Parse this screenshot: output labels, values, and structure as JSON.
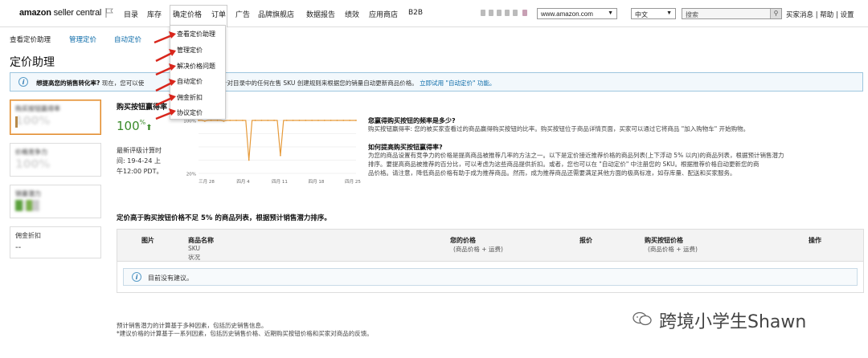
{
  "header": {
    "logo_bold": "amazon",
    "logo_rest": " seller central",
    "nav": [
      "目录",
      "库存",
      "确定价格",
      "订单",
      "广告",
      "品牌旗舰店",
      "数据报告",
      "绩效",
      "应用商店",
      "B2B"
    ],
    "marketplace": "www.amazon.com",
    "language": "中文",
    "search_placeholder": "搜索",
    "links": "买家消息 | 帮助 | 设置"
  },
  "dropdown": {
    "items": [
      "查看定价助理",
      "管理定价",
      "解决价格问题",
      "自动定价",
      "佣金折扣",
      "协议定价"
    ]
  },
  "subtabs": [
    "查看定价助理",
    "管理定价",
    "自动定价"
  ],
  "page_title": "定价助理",
  "banner": {
    "question": "想提高您的销售转化率?",
    "text_a": "现在，您可以使",
    "text_b": "\"自动定价\" 功能，针对目录中的任何在售 SKU 创建规则来根据您的销量自动更新商品价格。",
    "link": "立即试用 \"自动定价\" 功能。"
  },
  "cards": [
    {
      "title": "购买按钮赢得率",
      "value": "100%"
    },
    {
      "title": "价格竞争力",
      "value": "100%"
    },
    {
      "title": "销量潜力",
      "value": ""
    },
    {
      "title": "佣金折扣",
      "value": "--"
    }
  ],
  "metric": {
    "title": "购买按钮赢得率",
    "value": "100",
    "pct": "%",
    "trend_icon": "up-arrow-icon",
    "note_1": "最新评级计算时",
    "note_2": "间: 19-4-24 上",
    "note_3": "午12:00 PDT。"
  },
  "chart_data": {
    "type": "line",
    "x_ticks": [
      "三月 28",
      "四月 4",
      "四月 11",
      "四月 18",
      "四月 25"
    ],
    "y_ticks": [
      "100%",
      "20%"
    ],
    "ylim": [
      20,
      100
    ],
    "series": [
      {
        "values": [
          100,
          100,
          99,
          100,
          100,
          100,
          100,
          100,
          99,
          100,
          100,
          100,
          100,
          100,
          100,
          100,
          40,
          100,
          100,
          100,
          100,
          100,
          100,
          100,
          100,
          100,
          47,
          100,
          100,
          100,
          100,
          100,
          100,
          100,
          100,
          100,
          100,
          100,
          100,
          100,
          100,
          100,
          100,
          100,
          100,
          100,
          100,
          100,
          100,
          100,
          100
        ]
      }
    ],
    "color": "#e69a3a",
    "grid": true
  },
  "help": {
    "q1": "您赢得购买按钮的频率是多少?",
    "p1": "购买按钮赢得率: 您的被买家查看过的商品赢得购买按钮的比率。购买按钮位于商品详情页面，买家可以通过它将商品 \"加入购物车\" 开始购物。",
    "q2": "如何提高购买按钮赢得率?",
    "p2a": "为您的商品设置有竞争力的价格是提高商品被推荐几率的方法之一。以下是定价接近推荐价格的商品列表(上下浮动 5% 以内)的商品列表，根据预计销售潜力",
    "p2b": "排序。要提高商品被推荐的百分比，可以考虑为这些商品提供折扣。或者，您也可以在 \"自动定价\" 中注册您的 SKU。根据推荐价格自动更新您的商",
    "p2c": "品价格。请注意，降低商品价格有助于成为推荐商品。然而，成为推荐商品还需要满足其他方面的极高标准，如存库量、配送和买家服务。"
  },
  "table": {
    "caption": "定价高于购买按钮价格不足 5% 的商品列表，根据预计销售潜力排序。",
    "headers": [
      "图片",
      "商品名称",
      "您的价格",
      "报价",
      "购买按钮价格",
      "操作"
    ],
    "sub_name_1": "SKU",
    "sub_name_2": "状况",
    "sub_price": "(商品价格 + 运费)",
    "sub_bb": "(商品价格 + 运费)",
    "empty": "目前没有建议。"
  },
  "footnotes": [
    "预计销售潜力的计算基于多种因素，包括历史销售信息。",
    "*建议价格的计算基于一系列因素，包括历史销售价格、近期购买按钮价格和买家对商品的反馈。"
  ],
  "watermark": "跨境小学生Shawn"
}
